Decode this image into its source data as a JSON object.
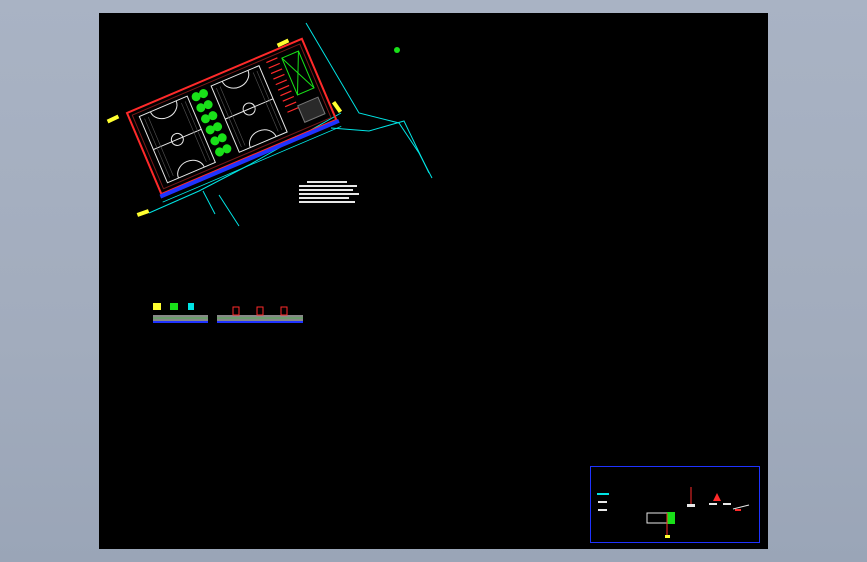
{
  "app": {
    "name": "",
    "drawing": ""
  },
  "colors": {
    "background": "#000000",
    "frame": "#a3adbf",
    "cyan": "#00e5e5",
    "green": "#19e019",
    "red": "#ff2a2a",
    "yellow": "#ffff30",
    "blue": "#1f33ff",
    "white": "#e8e8e8"
  },
  "icons": [
    "site-marker-icon",
    "crosshair-icon"
  ]
}
